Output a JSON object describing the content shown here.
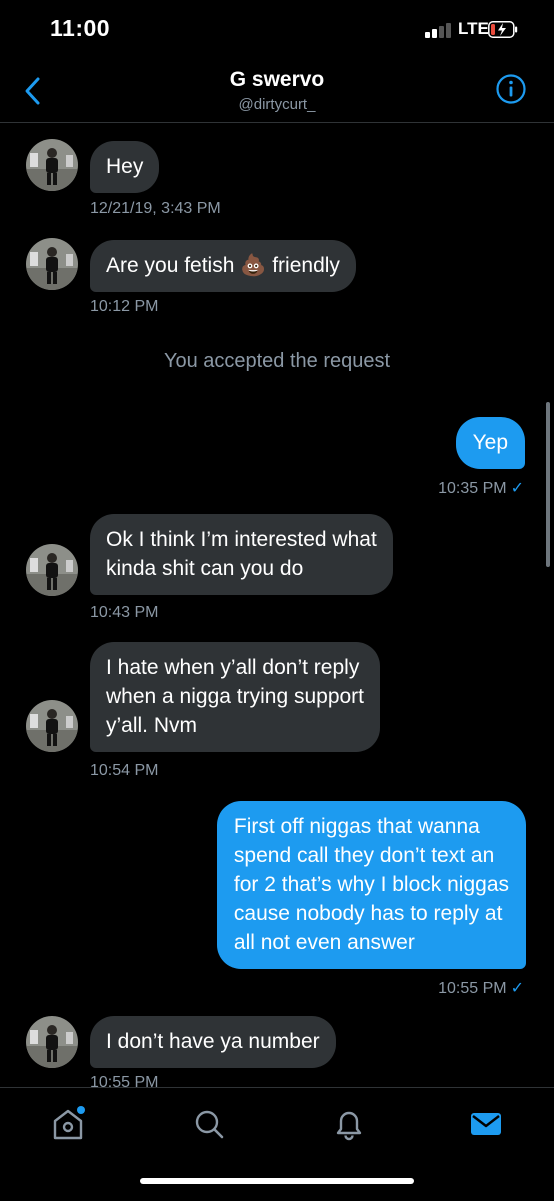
{
  "status": {
    "time": "11:00",
    "network": "LTE"
  },
  "header": {
    "name": "G swervo",
    "handle": "@dirtycurt_"
  },
  "messages": [
    {
      "text": "Hey",
      "time": "12/21/19, 3:43 PM"
    },
    {
      "text": "Are you fetish 💩 friendly",
      "time": "10:12 PM"
    },
    {
      "text": "You accepted the request"
    },
    {
      "text": "Yep",
      "time": "10:35 PM"
    },
    {
      "line1": "Ok I think I’m interested what",
      "line2": "kinda shit can you do",
      "time": "10:43 PM"
    },
    {
      "line1": "I hate when y’all don’t reply",
      "line2": "when a nigga trying support",
      "line3": "y’all. Nvm",
      "time": "10:54 PM"
    },
    {
      "line1": "First off niggas that wanna",
      "line2": "spend call they don’t text an",
      "line3": "for 2 that’s why I block niggas",
      "line4": "cause nobody has to reply at",
      "line5": "all not even answer",
      "time": "10:55 PM"
    },
    {
      "text": "I don’t have ya number",
      "time": "10:55 PM"
    }
  ],
  "colors": {
    "accent": "#1d9bf0",
    "incoming_bubble": "#2f3336",
    "secondary_text": "#8b98a5",
    "background": "#000000"
  },
  "icons": [
    "back-chevron-icon",
    "info-icon",
    "home-icon",
    "search-icon",
    "notifications-bell-icon",
    "messages-envelope-icon"
  ]
}
